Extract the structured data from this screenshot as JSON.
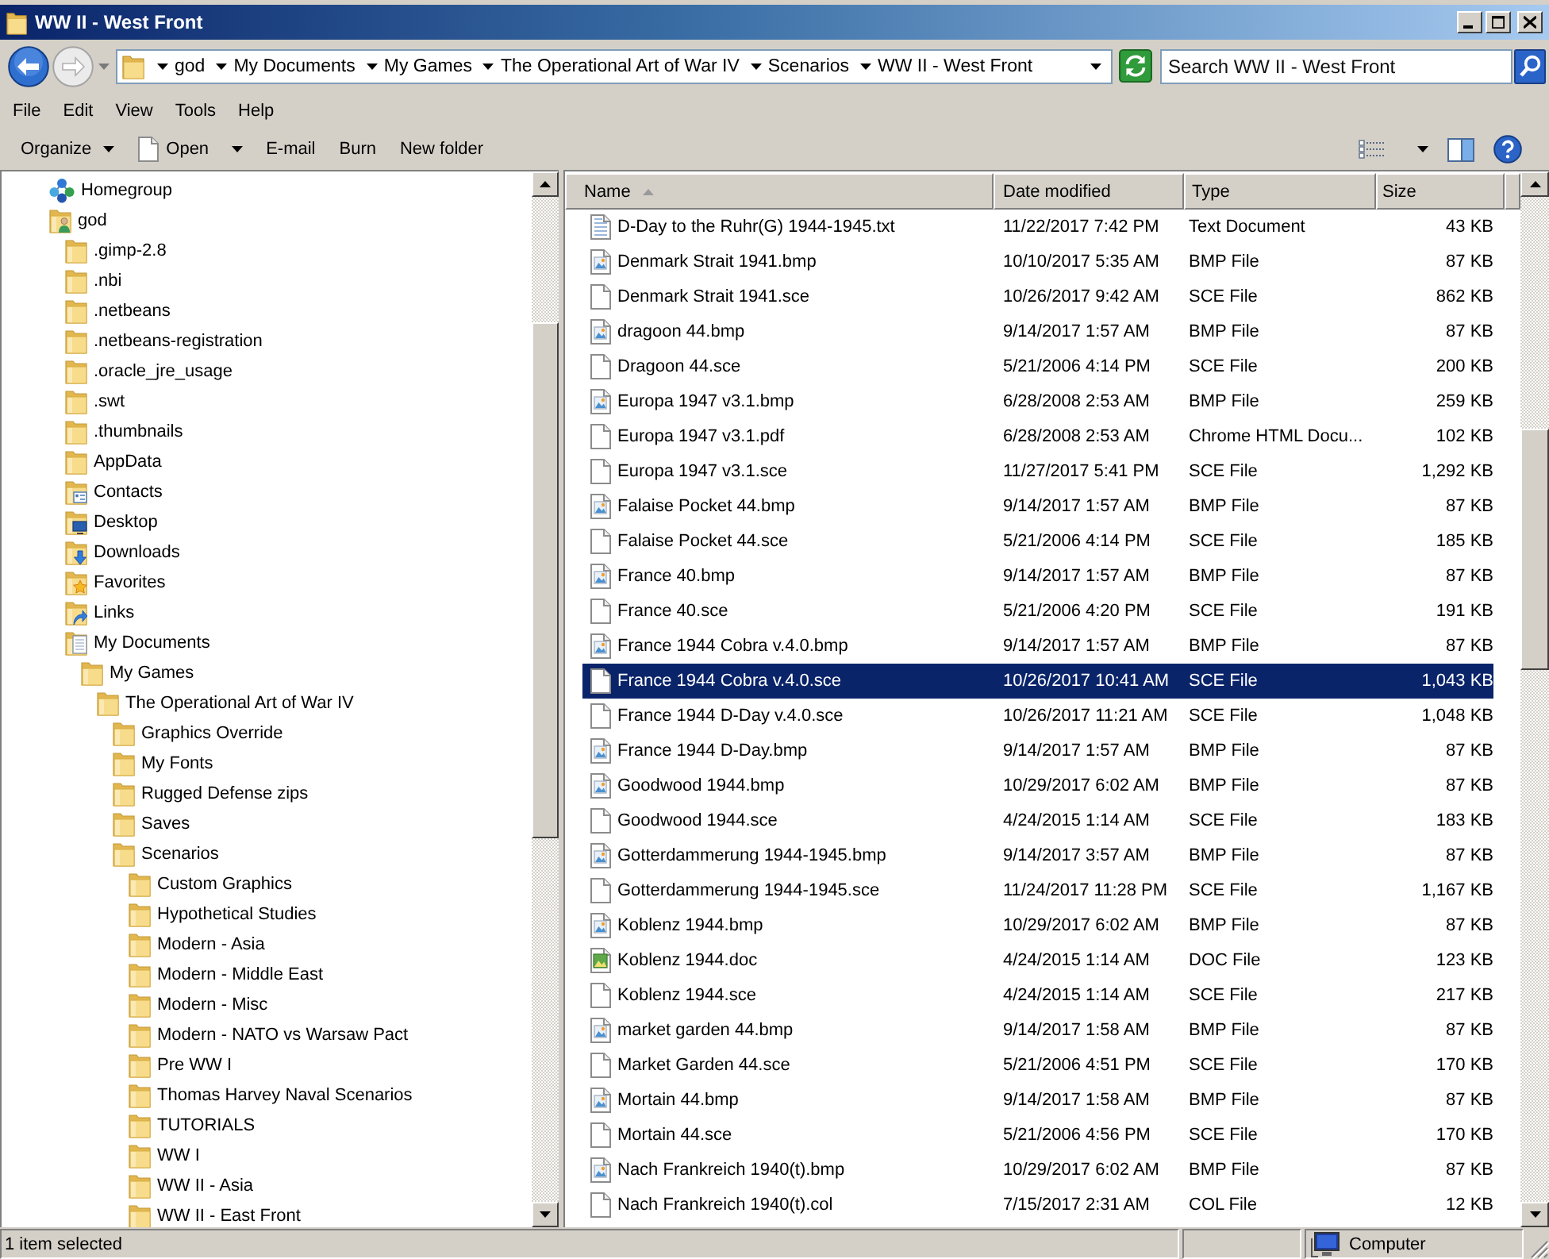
{
  "window": {
    "title": "WW II - West Front"
  },
  "address_bar": {
    "breadcrumbs": [
      "god",
      "My Documents",
      "My Games",
      "The Operational Art of War IV",
      "Scenarios",
      "WW II - West Front"
    ]
  },
  "search": {
    "placeholder": "Search WW II - West Front"
  },
  "menu": [
    "File",
    "Edit",
    "View",
    "Tools",
    "Help"
  ],
  "toolbar": [
    {
      "label": "Organize",
      "kind": "menu"
    },
    {
      "label": "Open",
      "kind": "open"
    },
    {
      "label": "E-mail",
      "kind": "plain"
    },
    {
      "label": "Burn",
      "kind": "plain"
    },
    {
      "label": "New folder",
      "kind": "plain"
    }
  ],
  "navigation": [
    {
      "label": "Homegroup",
      "kind": "homegroup"
    },
    {
      "label": "god",
      "kind": "user",
      "children": [
        {
          "label": ".gimp-2.8",
          "kind": "folder"
        },
        {
          "label": ".nbi",
          "kind": "folder"
        },
        {
          "label": ".netbeans",
          "kind": "folder"
        },
        {
          "label": ".netbeans-registration",
          "kind": "folder"
        },
        {
          "label": ".oracle_jre_usage",
          "kind": "folder"
        },
        {
          "label": ".swt",
          "kind": "folder"
        },
        {
          "label": ".thumbnails",
          "kind": "folder"
        },
        {
          "label": "AppData",
          "kind": "folder"
        },
        {
          "label": "Contacts",
          "kind": "contacts"
        },
        {
          "label": "Desktop",
          "kind": "desktop"
        },
        {
          "label": "Downloads",
          "kind": "downloads"
        },
        {
          "label": "Favorites",
          "kind": "favorites"
        },
        {
          "label": "Links",
          "kind": "links"
        },
        {
          "label": "My Documents",
          "kind": "documents",
          "children": [
            {
              "label": "My Games",
              "kind": "folder",
              "children": [
                {
                  "label": "The Operational Art of War IV",
                  "kind": "folder",
                  "children": [
                    {
                      "label": "Graphics Override",
                      "kind": "folder"
                    },
                    {
                      "label": "My Fonts",
                      "kind": "folder"
                    },
                    {
                      "label": "Rugged Defense zips",
                      "kind": "folder"
                    },
                    {
                      "label": "Saves",
                      "kind": "folder"
                    },
                    {
                      "label": "Scenarios",
                      "kind": "folder",
                      "children": [
                        {
                          "label": "Custom Graphics",
                          "kind": "folder"
                        },
                        {
                          "label": "Hypothetical Studies",
                          "kind": "folder"
                        },
                        {
                          "label": "Modern - Asia",
                          "kind": "folder"
                        },
                        {
                          "label": "Modern - Middle East",
                          "kind": "folder"
                        },
                        {
                          "label": "Modern - Misc",
                          "kind": "folder"
                        },
                        {
                          "label": "Modern - NATO vs Warsaw Pact",
                          "kind": "folder"
                        },
                        {
                          "label": "Pre WW I",
                          "kind": "folder"
                        },
                        {
                          "label": "Thomas Harvey Naval Scenarios",
                          "kind": "folder"
                        },
                        {
                          "label": "TUTORIALS",
                          "kind": "folder"
                        },
                        {
                          "label": "WW I",
                          "kind": "folder"
                        },
                        {
                          "label": "WW II - Asia",
                          "kind": "folder"
                        },
                        {
                          "label": "WW II - East Front",
                          "kind": "folder"
                        }
                      ]
                    }
                  ]
                }
              ]
            }
          ]
        }
      ]
    }
  ],
  "columns": [
    {
      "label": "Name",
      "sorted": true
    },
    {
      "label": "Date modified",
      "sorted": false
    },
    {
      "label": "Type",
      "sorted": false
    },
    {
      "label": "Size",
      "sorted": false
    }
  ],
  "files": [
    {
      "name": "D-Day to the Ruhr(G) 1944-1945.txt",
      "date": "11/22/2017 7:42 PM",
      "type": "Text Document",
      "size": "43 KB",
      "kind": "text",
      "selected": false
    },
    {
      "name": "Denmark Strait 1941.bmp",
      "date": "10/10/2017 5:35 AM",
      "type": "BMP File",
      "size": "87 KB",
      "kind": "image",
      "selected": false
    },
    {
      "name": "Denmark Strait 1941.sce",
      "date": "10/26/2017 9:42 AM",
      "type": "SCE File",
      "size": "862 KB",
      "kind": "blank",
      "selected": false
    },
    {
      "name": "dragoon 44.bmp",
      "date": "9/14/2017 1:57 AM",
      "type": "BMP File",
      "size": "87 KB",
      "kind": "image",
      "selected": false
    },
    {
      "name": "Dragoon 44.sce",
      "date": "5/21/2006 4:14 PM",
      "type": "SCE File",
      "size": "200 KB",
      "kind": "blank",
      "selected": false
    },
    {
      "name": "Europa 1947 v3.1.bmp",
      "date": "6/28/2008 2:53 AM",
      "type": "BMP File",
      "size": "259 KB",
      "kind": "image",
      "selected": false
    },
    {
      "name": "Europa 1947 v3.1.pdf",
      "date": "6/28/2008 2:53 AM",
      "type": "Chrome HTML Docu...",
      "size": "102 KB",
      "kind": "blank",
      "selected": false
    },
    {
      "name": "Europa 1947 v3.1.sce",
      "date": "11/27/2017 5:41 PM",
      "type": "SCE File",
      "size": "1,292 KB",
      "kind": "blank",
      "selected": false
    },
    {
      "name": "Falaise Pocket 44.bmp",
      "date": "9/14/2017 1:57 AM",
      "type": "BMP File",
      "size": "87 KB",
      "kind": "image",
      "selected": false
    },
    {
      "name": "Falaise Pocket 44.sce",
      "date": "5/21/2006 4:14 PM",
      "type": "SCE File",
      "size": "185 KB",
      "kind": "blank",
      "selected": false
    },
    {
      "name": "France 40.bmp",
      "date": "9/14/2017 1:57 AM",
      "type": "BMP File",
      "size": "87 KB",
      "kind": "image",
      "selected": false
    },
    {
      "name": "France 40.sce",
      "date": "5/21/2006 4:20 PM",
      "type": "SCE File",
      "size": "191 KB",
      "kind": "blank",
      "selected": false
    },
    {
      "name": "France 1944 Cobra v.4.0.bmp",
      "date": "9/14/2017 1:57 AM",
      "type": "BMP File",
      "size": "87 KB",
      "kind": "image",
      "selected": false
    },
    {
      "name": "France 1944 Cobra v.4.0.sce",
      "date": "10/26/2017 10:41 AM",
      "type": "SCE File",
      "size": "1,043 KB",
      "kind": "blank",
      "selected": true
    },
    {
      "name": "France 1944 D-Day v.4.0.sce",
      "date": "10/26/2017 11:21 AM",
      "type": "SCE File",
      "size": "1,048 KB",
      "kind": "blank",
      "selected": false
    },
    {
      "name": "France 1944 D-Day.bmp",
      "date": "9/14/2017 1:57 AM",
      "type": "BMP File",
      "size": "87 KB",
      "kind": "image",
      "selected": false
    },
    {
      "name": "Goodwood 1944.bmp",
      "date": "10/29/2017 6:02 AM",
      "type": "BMP File",
      "size": "87 KB",
      "kind": "image",
      "selected": false
    },
    {
      "name": "Goodwood 1944.sce",
      "date": "4/24/2015 1:14 AM",
      "type": "SCE File",
      "size": "183 KB",
      "kind": "blank",
      "selected": false
    },
    {
      "name": "Gotterdammerung 1944-1945.bmp",
      "date": "9/14/2017 3:57 AM",
      "type": "BMP File",
      "size": "87 KB",
      "kind": "image",
      "selected": false
    },
    {
      "name": "Gotterdammerung 1944-1945.sce",
      "date": "11/24/2017 11:28 PM",
      "type": "SCE File",
      "size": "1,167 KB",
      "kind": "blank",
      "selected": false
    },
    {
      "name": "Koblenz 1944.bmp",
      "date": "10/29/2017 6:02 AM",
      "type": "BMP File",
      "size": "87 KB",
      "kind": "image",
      "selected": false
    },
    {
      "name": "Koblenz 1944.doc",
      "date": "4/24/2015 1:14 AM",
      "type": "DOC File",
      "size": "123 KB",
      "kind": "picture",
      "selected": false
    },
    {
      "name": "Koblenz 1944.sce",
      "date": "4/24/2015 1:14 AM",
      "type": "SCE File",
      "size": "217 KB",
      "kind": "blank",
      "selected": false
    },
    {
      "name": "market garden 44.bmp",
      "date": "9/14/2017 1:58 AM",
      "type": "BMP File",
      "size": "87 KB",
      "kind": "image",
      "selected": false
    },
    {
      "name": "Market Garden 44.sce",
      "date": "5/21/2006 4:51 PM",
      "type": "SCE File",
      "size": "170 KB",
      "kind": "blank",
      "selected": false
    },
    {
      "name": "Mortain 44.bmp",
      "date": "9/14/2017 1:58 AM",
      "type": "BMP File",
      "size": "87 KB",
      "kind": "image",
      "selected": false
    },
    {
      "name": "Mortain 44.sce",
      "date": "5/21/2006 4:56 PM",
      "type": "SCE File",
      "size": "170 KB",
      "kind": "blank",
      "selected": false
    },
    {
      "name": "Nach Frankreich 1940(t).bmp",
      "date": "10/29/2017 6:02 AM",
      "type": "BMP File",
      "size": "87 KB",
      "kind": "image",
      "selected": false
    },
    {
      "name": "Nach Frankreich 1940(t).col",
      "date": "7/15/2017 2:31 AM",
      "type": "COL File",
      "size": "12 KB",
      "kind": "blank",
      "selected": false
    }
  ],
  "status_bar": {
    "selection": "1 item selected",
    "location": "Computer"
  }
}
